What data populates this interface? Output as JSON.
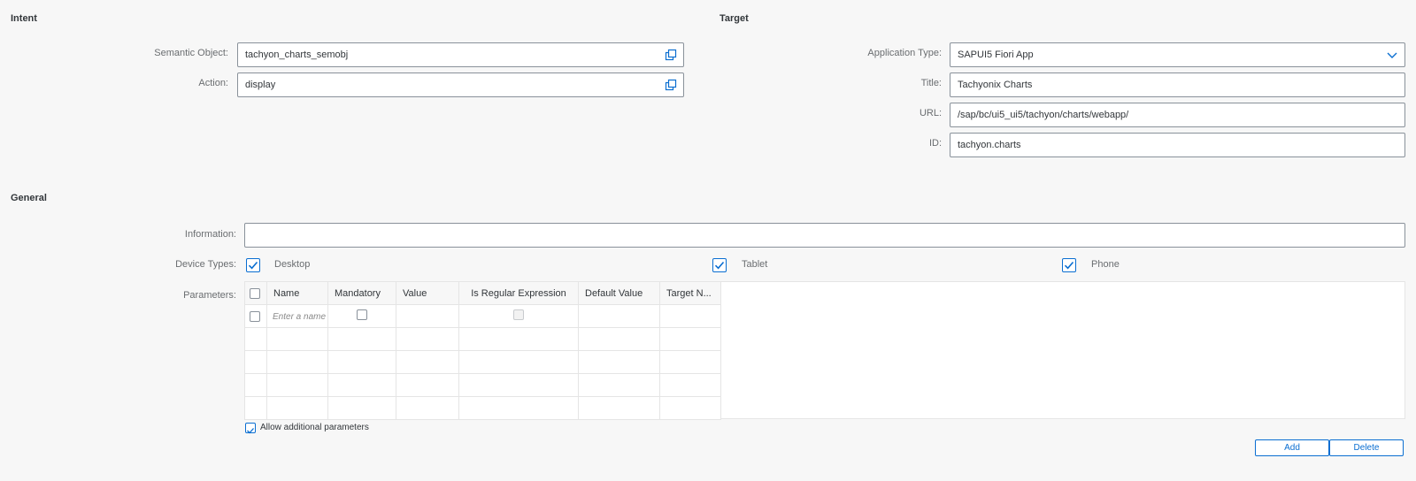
{
  "intent": {
    "title": "Intent",
    "semantic_object": {
      "label": "Semantic Object:",
      "value": "tachyon_charts_semobj"
    },
    "action": {
      "label": "Action:",
      "value": "display"
    }
  },
  "target": {
    "title": "Target",
    "application_type": {
      "label": "Application Type:",
      "value": "SAPUI5 Fiori App"
    },
    "title_field": {
      "label": "Title:",
      "value": "Tachyonix Charts"
    },
    "url": {
      "label": "URL:",
      "value": "/sap/bc/ui5_ui5/tachyon/charts/webapp/"
    },
    "id": {
      "label": "ID:",
      "value": "tachyon.charts"
    }
  },
  "general": {
    "title": "General",
    "information": {
      "label": "Information:",
      "value": ""
    },
    "device_types": {
      "label": "Device Types:",
      "desktop": {
        "label": "Desktop",
        "checked": true
      },
      "tablet": {
        "label": "Tablet",
        "checked": true
      },
      "phone": {
        "label": "Phone",
        "checked": true
      }
    },
    "parameters": {
      "label": "Parameters:",
      "columns": [
        "Name",
        "Mandatory",
        "Value",
        "Is Regular Expression",
        "Default Value",
        "Target N..."
      ],
      "name_placeholder": "Enter a name"
    },
    "allow_additional": {
      "label": "Allow additional parameters",
      "checked": true
    },
    "add_label": "Add",
    "delete_label": "Delete"
  },
  "colors": {
    "accent": "#0a6ed1",
    "border": "#89919a",
    "background": "#f7f7f7"
  }
}
